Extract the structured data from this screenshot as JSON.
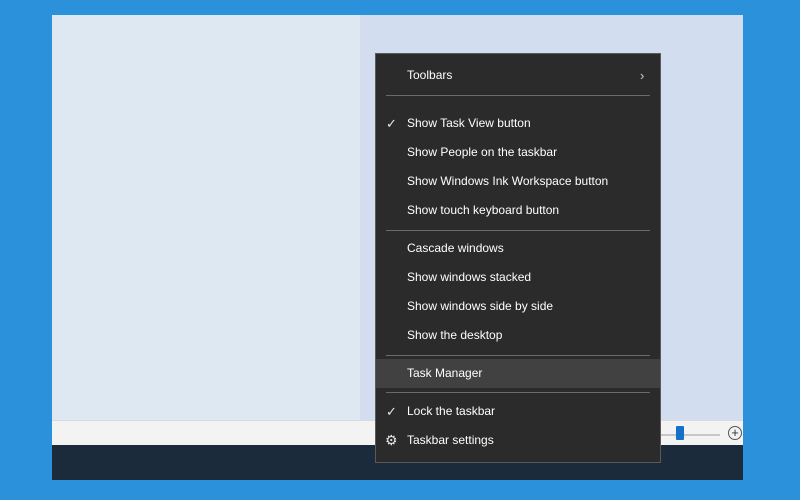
{
  "menu": {
    "items": [
      {
        "label": "Toolbars",
        "checked": false,
        "submenu": true
      },
      {
        "label": "Show Task View button",
        "checked": true
      },
      {
        "label": "Show People on the taskbar",
        "checked": false
      },
      {
        "label": "Show Windows Ink Workspace button",
        "checked": false
      },
      {
        "label": "Show touch keyboard button",
        "checked": false
      },
      {
        "label": "Cascade windows",
        "checked": false
      },
      {
        "label": "Show windows stacked",
        "checked": false
      },
      {
        "label": "Show windows side by side",
        "checked": false
      },
      {
        "label": "Show the desktop",
        "checked": false
      },
      {
        "label": "Task Manager",
        "checked": false,
        "highlighted": true
      },
      {
        "label": "Lock the taskbar",
        "checked": true
      },
      {
        "label": "Taskbar settings",
        "icon": "gear-icon"
      }
    ]
  },
  "icons": {
    "check": "✓",
    "chevron": "›",
    "gear": "⚙",
    "zoom_plus": "+"
  },
  "colors": {
    "menu_background": "#2b2b2b",
    "menu_highlight": "#414141",
    "frame_background": "#2a91da",
    "taskbar": "#1c2b3c",
    "slider_accent": "#1470c8"
  }
}
